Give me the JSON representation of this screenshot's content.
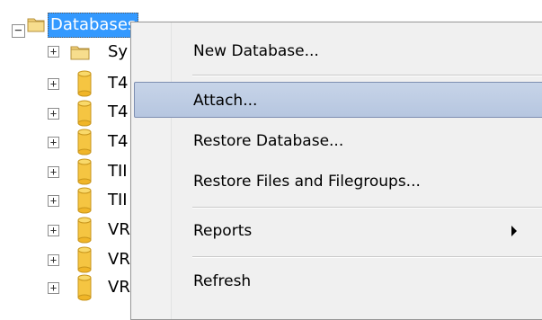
{
  "tree": {
    "root": {
      "label": "Databases",
      "expander": "−"
    },
    "children": [
      {
        "label": "Sy",
        "icon": "folder-icon",
        "expander": "+"
      },
      {
        "label": "T4",
        "icon": "database-icon",
        "expander": "+"
      },
      {
        "label": "T4",
        "icon": "database-icon",
        "expander": "+"
      },
      {
        "label": "T4",
        "icon": "database-icon",
        "expander": "+"
      },
      {
        "label": "TII",
        "icon": "database-icon",
        "expander": "+"
      },
      {
        "label": "TII",
        "icon": "database-icon",
        "expander": "+"
      },
      {
        "label": "VR",
        "icon": "database-icon",
        "expander": "+"
      },
      {
        "label": "VR",
        "icon": "database-icon",
        "expander": "+"
      },
      {
        "label": "VR",
        "icon": "database-icon",
        "expander": "+"
      }
    ]
  },
  "context_menu": {
    "items": [
      {
        "label": "New Database..."
      },
      {
        "label": "Attach..."
      },
      {
        "label": "Restore Database..."
      },
      {
        "label": "Restore Files and Filegroups..."
      },
      {
        "label": "Reports"
      },
      {
        "label": "Refresh"
      }
    ]
  },
  "colors": {
    "selection": "#3399ff",
    "menu_highlight": "#b6c6e0",
    "database_yellow": "#f5c542"
  }
}
